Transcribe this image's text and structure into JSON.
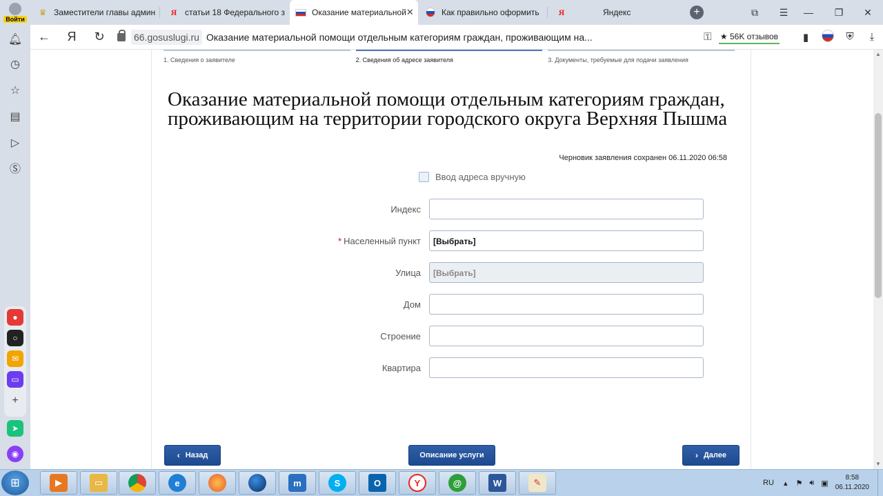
{
  "browser": {
    "login_label": "Войти",
    "tabs": [
      {
        "title": "Заместители главы админ",
        "favicon": "gerb"
      },
      {
        "title": "статьи 18 Федерального з",
        "favicon": "yandex"
      },
      {
        "title": "Оказание материальной",
        "favicon": "ru-flag",
        "active": true
      },
      {
        "title": "Как правильно оформить",
        "favicon": "ru-flag-round"
      },
      {
        "title": "Яндекс",
        "favicon": "yandex"
      }
    ],
    "new_tab_icon": "+",
    "url_domain": "66.gosuslugi.ru",
    "page_title_in_url": "Оказание материальной помощи отдельным категориям граждан, проживающим на...",
    "reviews_badge": "★ 56K отзывов",
    "nav_glyph_yandex": "Я"
  },
  "steps": [
    {
      "label": "1. Сведения о заявителе",
      "active": false
    },
    {
      "label": "2. Сведения об адресе заявителя",
      "active": true
    },
    {
      "label": "3. Документы, требуемые для подачи заявления",
      "active": false
    }
  ],
  "form": {
    "title": "Оказание материальной помощи отдельным категориям граждан, проживающим на территории городского округа Верхняя Пышма",
    "draft_saved": "Черновик заявления сохранен 06.11.2020 06:58",
    "manual_address_label": "Ввод адреса вручную",
    "fields": [
      {
        "label": "Индекс",
        "value": "",
        "required": false,
        "disabled": false
      },
      {
        "label": "Населенный пункт",
        "value": "[Выбрать]",
        "required": true,
        "disabled": false
      },
      {
        "label": "Улица",
        "value": "[Выбрать]",
        "required": false,
        "disabled": true
      },
      {
        "label": "Дом",
        "value": "",
        "required": false,
        "disabled": false
      },
      {
        "label": "Строение",
        "value": "",
        "required": false,
        "disabled": false
      },
      {
        "label": "Квартира",
        "value": "",
        "required": false,
        "disabled": false
      }
    ],
    "required_mark": "*",
    "buttons": {
      "back": "Назад",
      "description": "Описание услуги",
      "next": "Далее"
    }
  },
  "taskbar": {
    "language": "RU",
    "time": "8:58",
    "date": "06.11.2020"
  },
  "colors": {
    "accent": "#1d4a8f",
    "required": "#d0021b",
    "yandex": "#e22222"
  }
}
